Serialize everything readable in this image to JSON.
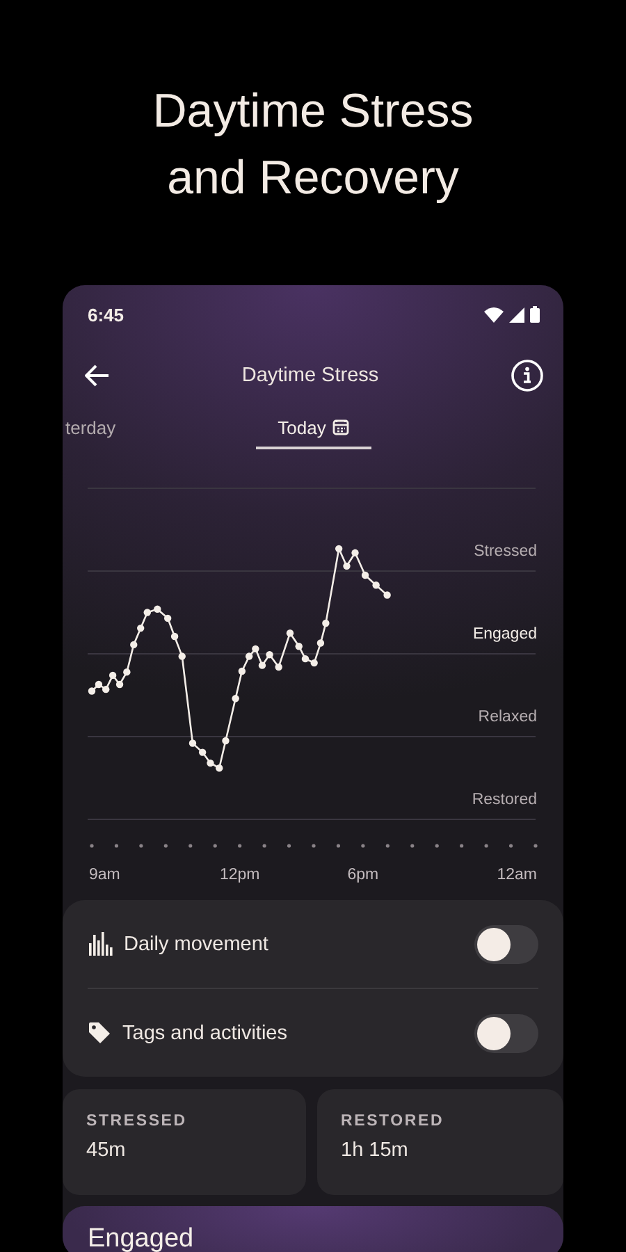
{
  "headline": "Daytime Stress and Recovery",
  "status_bar": {
    "time": "6:45"
  },
  "app_bar": {
    "title": "Daytime Stress"
  },
  "tabs": [
    {
      "label": "terday",
      "selected": false
    },
    {
      "label": "Today",
      "selected": true
    }
  ],
  "chart": {
    "kind": "picture",
    "level_labels": [
      {
        "label": "Stressed",
        "current": false
      },
      {
        "label": "Engaged",
        "current": true
      },
      {
        "label": "Relaxed",
        "current": false
      },
      {
        "label": "Restored",
        "current": false
      }
    ],
    "time_labels": [
      "9am",
      "12pm",
      "6pm",
      "12am"
    ]
  },
  "toggles": [
    {
      "kind": "movement",
      "label": "Daily movement",
      "on": false
    },
    {
      "kind": "tags",
      "label": "Tags and activities",
      "on": false
    }
  ],
  "stats": [
    {
      "label": "STRESSED",
      "value": "45m"
    },
    {
      "label": "RESTORED",
      "value": "1h 15m"
    }
  ],
  "level_card": {
    "title": "Engaged"
  }
}
